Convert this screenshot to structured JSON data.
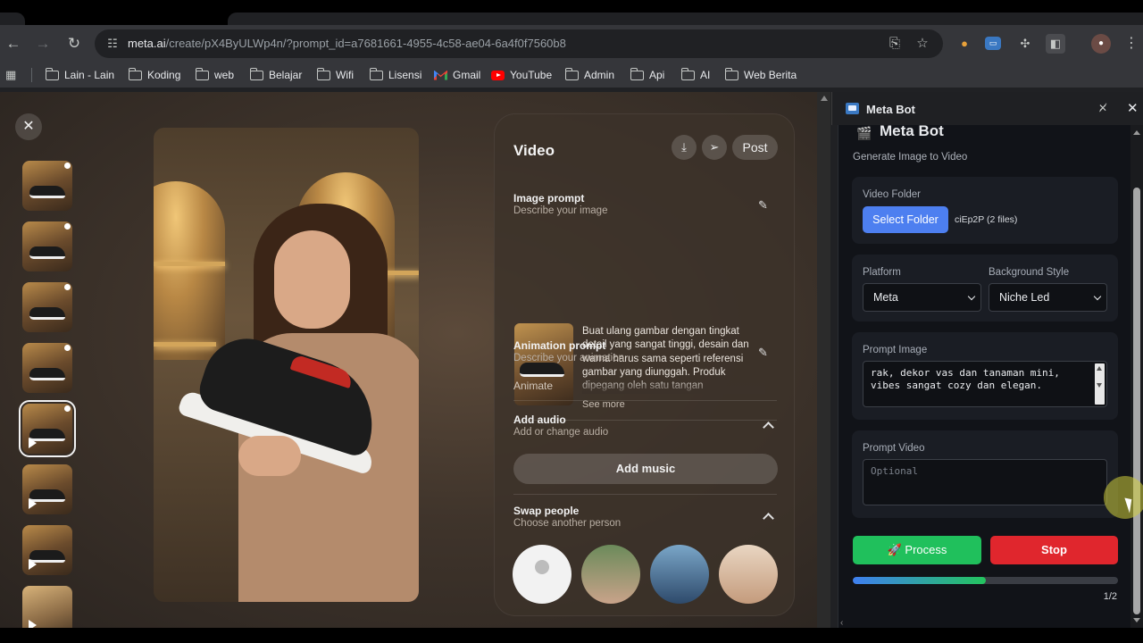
{
  "browser": {
    "url_host": "meta.ai",
    "url_path": "/create/pX4ByULWp4n/?prompt_id=a7681661-4955-4c58-ae04-6a4f0f7560b8",
    "bookmarks": [
      {
        "label": "Lain - Lain",
        "icon": "folder-icon"
      },
      {
        "label": "Koding",
        "icon": "folder-icon"
      },
      {
        "label": "web",
        "icon": "folder-icon"
      },
      {
        "label": "Belajar",
        "icon": "folder-icon"
      },
      {
        "label": "Wifi",
        "icon": "folder-icon"
      },
      {
        "label": "Lisensi",
        "icon": "folder-icon"
      },
      {
        "label": "Gmail",
        "icon": "gmail-icon"
      },
      {
        "label": "YouTube",
        "icon": "youtube-icon"
      },
      {
        "label": "Admin",
        "icon": "folder-icon"
      },
      {
        "label": "Api",
        "icon": "folder-icon"
      },
      {
        "label": "AI",
        "icon": "folder-icon"
      },
      {
        "label": "Web Berita",
        "icon": "folder-icon"
      }
    ]
  },
  "video_panel": {
    "title": "Video",
    "post_label": "Post",
    "image_prompt": {
      "title": "Image prompt",
      "subtitle": "Describe your image",
      "text": "Buat ulang gambar dengan tingkat detail yang sangat tinggi, desain dan warna harus sama seperti referensi gambar yang diunggah. Produk dipegang oleh satu tangan",
      "see_more": "See more"
    },
    "animation_prompt": {
      "title": "Animation prompt",
      "subtitle": "Describe your animation",
      "value": "Animate"
    },
    "add_audio": {
      "title": "Add audio",
      "subtitle": "Add or change audio",
      "button": "Add music"
    },
    "swap_people": {
      "title": "Swap people",
      "subtitle": "Choose another person"
    }
  },
  "side_panel": {
    "header_title": "Meta Bot",
    "app_title": "Meta Bot",
    "app_subtitle": "Generate Image to Video",
    "video_folder": {
      "label": "Video Folder",
      "button": "Select Folder",
      "info": "ciEp2P (2 files)"
    },
    "platform": {
      "label": "Platform",
      "value": "Meta"
    },
    "background_style": {
      "label": "Background Style",
      "value": "Niche Led"
    },
    "prompt_image": {
      "label": "Prompt Image",
      "value": "rak, dekor vas dan tanaman mini,\nvibes sangat cozy dan elegan."
    },
    "prompt_video": {
      "label": "Prompt Video",
      "placeholder": "Optional"
    },
    "process_label": "Process",
    "stop_label": "Stop",
    "progress_fraction": 0.5,
    "progress_text": "1/2"
  },
  "colors": {
    "process": "#20c05c",
    "stop": "#e0262d",
    "select_folder": "#4d7ff0"
  }
}
